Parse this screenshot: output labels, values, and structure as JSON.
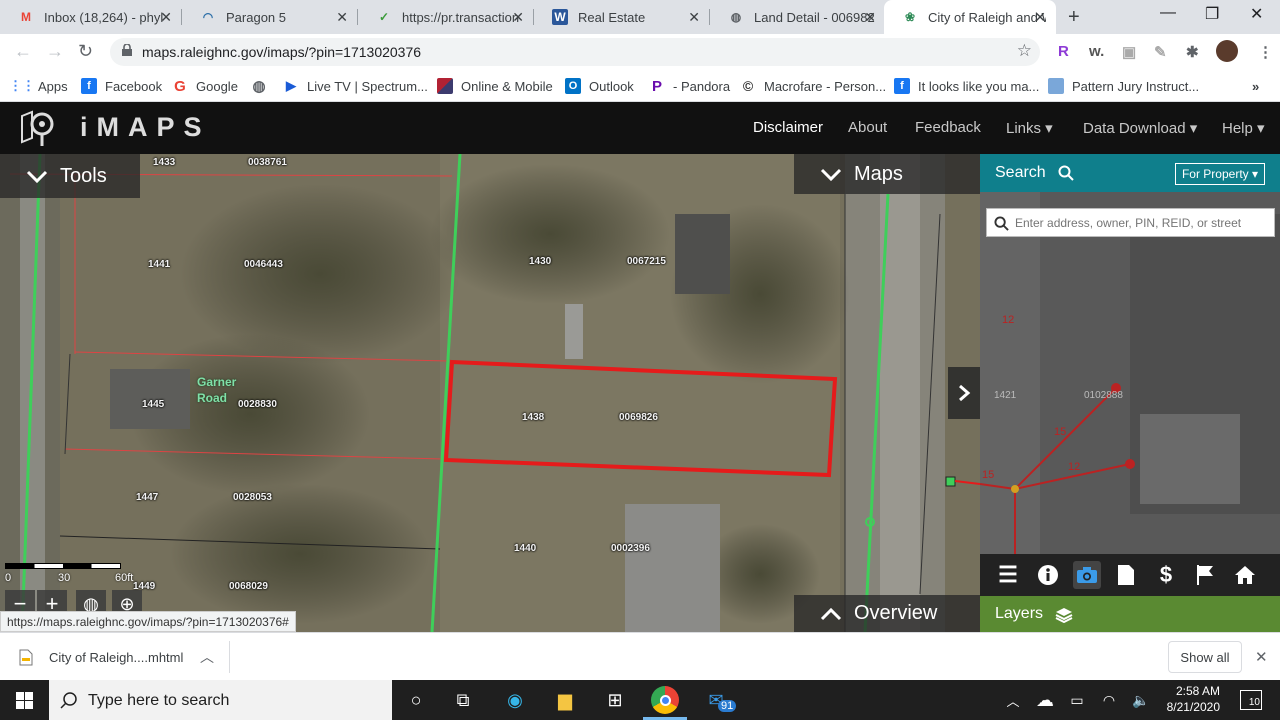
{
  "browser": {
    "tabs": [
      {
        "title": "Inbox (18,264) - phyl",
        "icon": "gmail-icon",
        "active": false
      },
      {
        "title": "Paragon 5",
        "icon": "paragon-icon",
        "active": false
      },
      {
        "title": "https://pr.transaction",
        "icon": "transaction-icon",
        "active": false
      },
      {
        "title": "Real Estate",
        "icon": "word-icon",
        "active": false
      },
      {
        "title": "Land Detail - 006982",
        "icon": "globe-icon",
        "active": false
      },
      {
        "title": "City of Raleigh and W",
        "icon": "raleigh-icon",
        "active": true
      }
    ],
    "url": "maps.raleighnc.gov/imaps/?pin=1713020376",
    "bookmarks": [
      {
        "label": "Apps",
        "icon": "apps-grid-icon",
        "color": "#4285f4"
      },
      {
        "label": "Facebook",
        "icon": "facebook-icon",
        "color": "#1877f2"
      },
      {
        "label": "Google",
        "icon": "google-icon",
        "color": "#ea4335"
      },
      {
        "label": "",
        "icon": "globe-icon",
        "color": "#5f6368"
      },
      {
        "label": "Live TV | Spectrum...",
        "icon": "play-icon",
        "color": "#1a5bd6"
      },
      {
        "label": "Online & Mobile",
        "icon": "flag-us-icon",
        "color": "#b22234"
      },
      {
        "label": "Outlook",
        "icon": "outlook-icon",
        "color": "#0072c6"
      },
      {
        "label": "- Pandora",
        "icon": "pandora-icon",
        "color": "#6a0dad"
      },
      {
        "label": "Macrofare - Person...",
        "icon": "macrofare-icon",
        "color": "#333"
      },
      {
        "label": "It looks like you ma...",
        "icon": "facebook-icon",
        "color": "#1877f2"
      },
      {
        "label": "Pattern Jury Instruct...",
        "icon": "document-icon",
        "color": "#7aa7d9"
      }
    ]
  },
  "imaps": {
    "brand": "iMAPS",
    "nav": [
      {
        "label": "Disclaimer",
        "selected": true
      },
      {
        "label": "About",
        "selected": false
      },
      {
        "label": "Feedback",
        "selected": false
      },
      {
        "label": "Links ▾",
        "selected": false
      },
      {
        "label": "Data Download ▾",
        "selected": false
      },
      {
        "label": "Help ▾",
        "selected": false
      }
    ],
    "tools_label": "Tools",
    "maps_label": "Maps",
    "overview_label": "Overview",
    "search": {
      "title": "Search",
      "mode": "For Property ▾",
      "placeholder": "Enter address, owner, PIN, REID, or street"
    },
    "layers_label": "Layers",
    "scale": {
      "zero": "0",
      "mid": "30",
      "end": "60ft"
    },
    "parcels": [
      {
        "num": "1433",
        "id": "0038761"
      },
      {
        "num": "1441",
        "id": "0046443"
      },
      {
        "num": "1430",
        "id": "0067215"
      },
      {
        "num": "1445",
        "id": "0028830"
      },
      {
        "num": "1438",
        "id": "0069826"
      },
      {
        "num": "1447",
        "id": "0028053"
      },
      {
        "num": "1440",
        "id": "0002396"
      },
      {
        "num": "1449",
        "id": "0068029"
      },
      {
        "num": "1421",
        "id": "0102888"
      }
    ],
    "street": "Garner Road",
    "measure_labels": [
      "15",
      "12",
      "15",
      "12"
    ]
  },
  "status_url": "https://maps.raleighnc.gov/imaps/?pin=1713020376#",
  "download": {
    "filename": "City of Raleigh....mhtml",
    "show_all": "Show all"
  },
  "taskbar": {
    "search_placeholder": "Type here to search",
    "mail_badge": "91",
    "time": "2:58 AM",
    "date": "8/21/2020",
    "notifications": "10"
  }
}
